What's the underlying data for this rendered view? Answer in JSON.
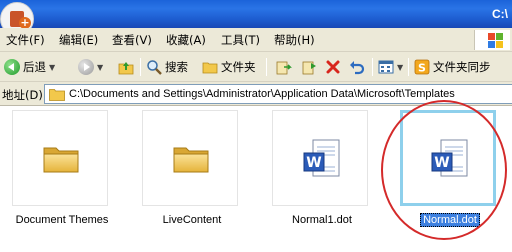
{
  "window": {
    "title": "C:\\"
  },
  "menu": [
    {
      "label": "文件(F)"
    },
    {
      "label": "编辑(E)"
    },
    {
      "label": "查看(V)"
    },
    {
      "label": "收藏(A)"
    },
    {
      "label": "工具(T)"
    },
    {
      "label": "帮助(H)"
    }
  ],
  "toolbar": {
    "back_label": "后退",
    "search_label": "搜索",
    "folders_label": "文件夹",
    "sync_label": "文件夹同步"
  },
  "address": {
    "label": "地址(D)",
    "path": "C:\\Documents and Settings\\Administrator\\Application Data\\Microsoft\\Templates"
  },
  "files": [
    {
      "name": "Document Themes",
      "type": "folder-icon",
      "selected": false
    },
    {
      "name": "LiveContent",
      "type": "folder-icon",
      "selected": false
    },
    {
      "name": "Normal1.dot",
      "type": "word-document-icon",
      "selected": false
    },
    {
      "name": "Normal.dot",
      "type": "word-document-icon",
      "selected": true
    }
  ],
  "colors": {
    "titlebar": "#2a74e6",
    "chrome": "#ece9d8",
    "selection": "#3d80df",
    "highlight_circle": "#d42a2a"
  }
}
